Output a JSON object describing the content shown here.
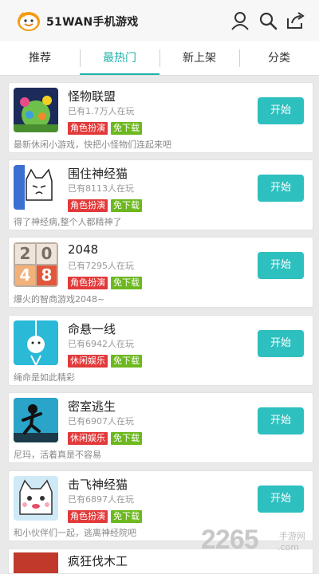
{
  "header": {
    "brand": "51WAN手机游戏",
    "icons": [
      "user-icon",
      "search-icon",
      "share-icon"
    ]
  },
  "tabs": [
    {
      "label": "推荐",
      "active": false
    },
    {
      "label": "最热门",
      "active": true
    },
    {
      "label": "新上架",
      "active": false
    },
    {
      "label": "分类",
      "active": false
    }
  ],
  "colors": {
    "accent": "#2ebfbf",
    "badge_red": "#e23a3a",
    "badge_green": "#6cb81e"
  },
  "games": [
    {
      "title": "怪物联盟",
      "players": "已有1.7万人在玩",
      "tags": [
        "角色扮演",
        "免下载"
      ],
      "desc": "最新休闲小游戏，快把小怪物们连起来吧",
      "button": "开始"
    },
    {
      "title": "围住神经猫",
      "players": "已有8113人在玩",
      "tags": [
        "角色扮演",
        "免下载"
      ],
      "desc": "得了神经病,整个人都精神了",
      "button": "开始"
    },
    {
      "title": "2048",
      "players": "已有7295人在玩",
      "tags": [
        "角色扮演",
        "免下载"
      ],
      "desc": "爆火的智商游戏2048~",
      "button": "开始"
    },
    {
      "title": "命悬一线",
      "players": "已有6942人在玩",
      "tags": [
        "休闲娱乐",
        "免下载"
      ],
      "desc": "绳命是如此精彩",
      "button": "开始"
    },
    {
      "title": "密室逃生",
      "players": "已有6907人在玩",
      "tags": [
        "休闲娱乐",
        "免下载"
      ],
      "desc": "尼玛，活着真是不容易",
      "button": "开始"
    },
    {
      "title": "击飞神经猫",
      "players": "已有6897人在玩",
      "tags": [
        "角色扮演",
        "免下载"
      ],
      "desc": "和小伙伴们一起，逃离神经院吧",
      "button": "开始"
    }
  ],
  "partial_game": {
    "title": "疯狂伐木工"
  },
  "thumb_2048": [
    "2",
    "0",
    "4",
    "8"
  ],
  "watermark": {
    "number": "2265",
    "site": "手游网",
    "url": ".com"
  }
}
